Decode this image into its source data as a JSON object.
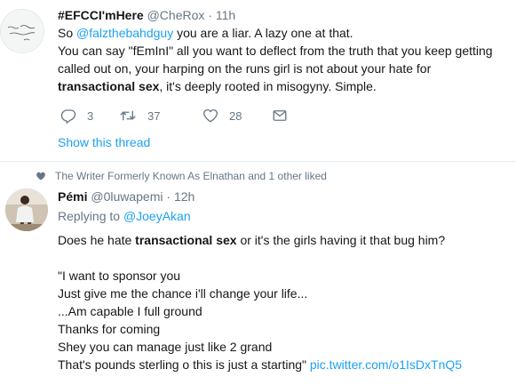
{
  "tweet1": {
    "name": "#EFCCI'mHere",
    "handle": "@CheRox",
    "dot": "·",
    "time": "11h",
    "line1_pre": "So ",
    "line1_link": "@falzthebahdguy",
    "line1_post": " you are a liar. A lazy one at that.",
    "line2": "You can say \"fEmInI\" all you want to deflect from the truth that you keep getting",
    "line3": "called out on, your harping on the runs girl is not about your hate for",
    "line4_bold": "transactional sex",
    "line4_post": ", it's deeply rooted in misogyny. Simple.",
    "reply_count": "3",
    "retweet_count": "37",
    "like_count": "28",
    "show_thread": "Show this thread",
    "icons": {
      "reply": "reply-icon",
      "retweet": "retweet-icon",
      "like": "heart-icon",
      "dm": "envelope-icon"
    }
  },
  "tweet2": {
    "liked_by": "The Writer Formerly Known As Elnathan and 1 other liked",
    "name": "Pémi",
    "handle": "@0luwapemi",
    "dot": "·",
    "time": "12h",
    "replying_prefix": "Replying to ",
    "replying_handle": "@JoeyAkan",
    "q_pre": "Does he hate ",
    "q_bold": "transactional sex",
    "q_post": " or it's the girls having it that bug him?",
    "lyric1": "\"I want to sponsor you",
    "lyric2": "Just give me the chance i'll change your life...",
    "lyric3": "...Am capable I full ground",
    "lyric4": "Thanks for coming",
    "lyric5": "Shey you can manage just like 2 grand",
    "lyric6_pre": "That's pounds sterling o this is just a starting\" ",
    "lyric6_link": "pic.twitter.com/o1IsDxTnQ5"
  },
  "colors": {
    "link": "#1da1f2",
    "secondary": "#657786",
    "text": "#14171a",
    "divider": "#e6ecf0"
  }
}
